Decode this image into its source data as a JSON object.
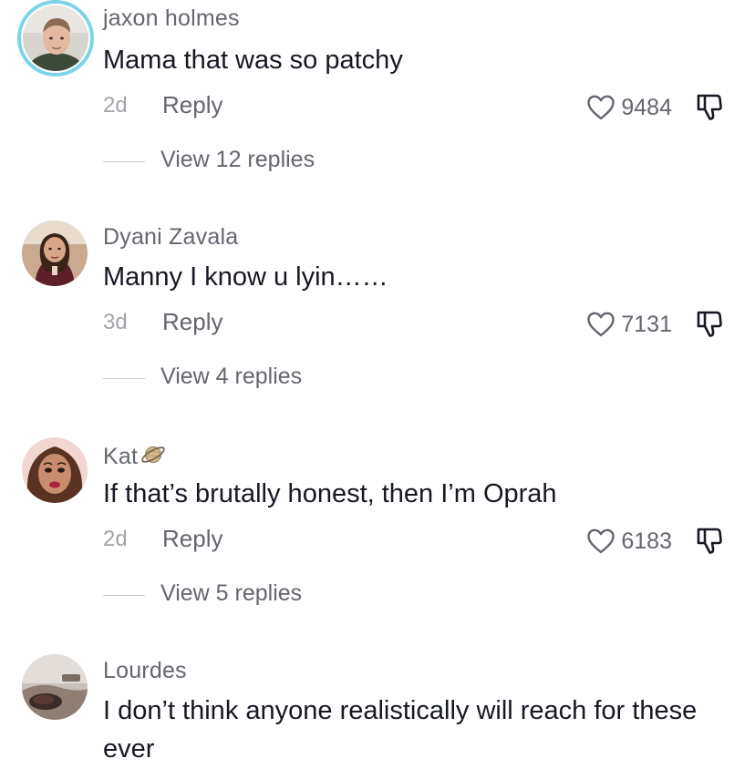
{
  "comments": [
    {
      "username": "jaxon holmes",
      "text": "Mama that was so patchy",
      "time": "2d",
      "reply_label": "Reply",
      "likes": "9484",
      "view_replies": "View 12 replies"
    },
    {
      "username": "Dyani Zavala",
      "text": "Manny I know u lyin……",
      "time": "3d",
      "reply_label": "Reply",
      "likes": "7131",
      "view_replies": "View 4 replies"
    },
    {
      "username": "Kat",
      "username_emoji": "saturn-icon",
      "text": "If that’s brutally honest, then I’m Oprah",
      "time": "2d",
      "reply_label": "Reply",
      "likes": "6183",
      "view_replies": "View 5 replies"
    },
    {
      "username": "Lourdes",
      "text": "I don’t think anyone realistically will reach for these ever"
    }
  ],
  "icons": {
    "like": "heart-outline-icon",
    "dislike": "thumbs-down-icon"
  },
  "colors": {
    "story_ring": "#7cd4e8",
    "secondary_text": "#646670",
    "muted_text": "#a2a3a9",
    "primary_text": "#161823"
  }
}
